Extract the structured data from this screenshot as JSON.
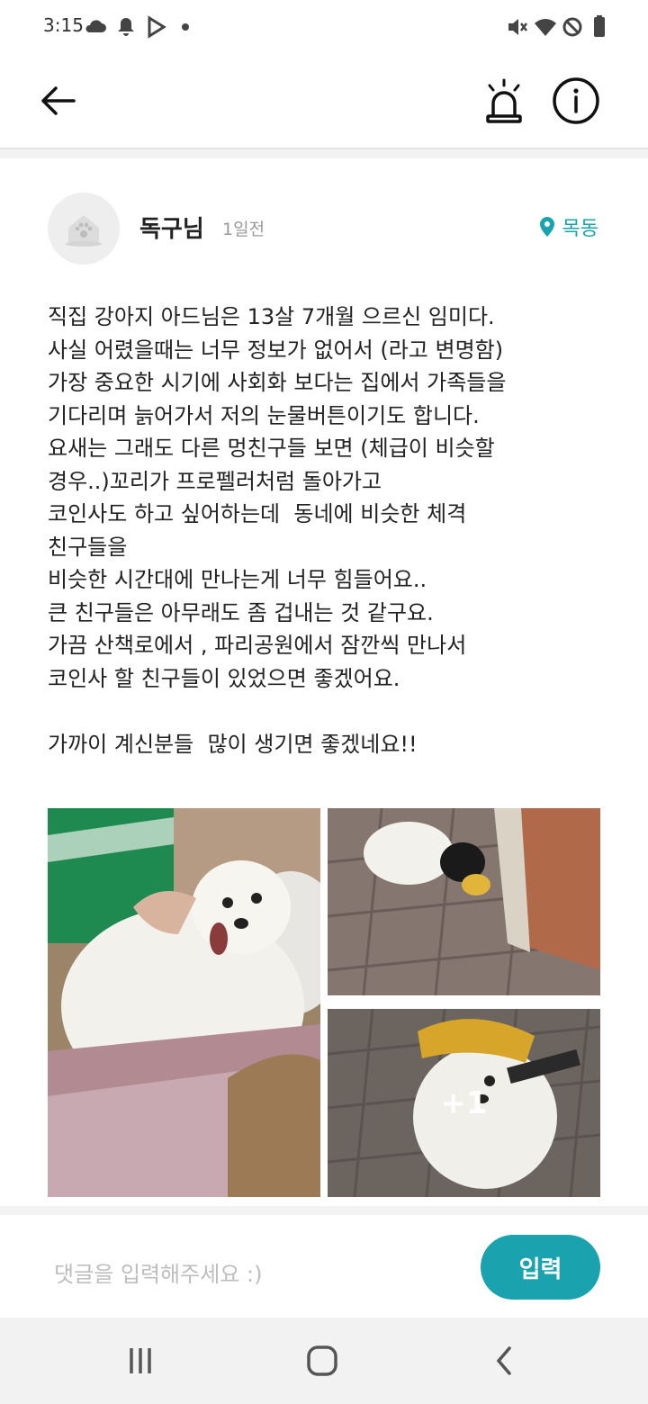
{
  "status_bar": {
    "time": "3:15",
    "left_icons": [
      "cloud-icon",
      "bell-icon",
      "play-store-icon",
      "dot-icon"
    ],
    "right_icons": [
      "mute-icon",
      "wifi-icon",
      "do-not-disturb-icon",
      "battery-icon"
    ]
  },
  "app_bar": {
    "back_icon": "arrow-left-icon",
    "report_icon": "siren-icon",
    "info_icon": "info-icon"
  },
  "post": {
    "author": "독구님",
    "time_ago": "1일전",
    "location": "목동",
    "body": "직집 강아지 아드님은 13살 7개월 으르신 임미다.\n사실 어렸을때는 너무 정보가 없어서 (라고 변명함)\n가장 중요한 시기에 사회화 보다는 집에서 가족들을\n기다리며 늙어가서 저의 눈물버튼이기도 합니다.\n요새는 그래도 다른 멍친구들 보면 (체급이 비슷할\n경우..)꼬리가 프로펠러처럼 돌아가고\n코인사도 하고 싶어하는데  동네에 비슷한 체격\n친구들을\n비슷한 시간대에 만나는게 너무 힘들어요..\n큰 친구들은 아무래도 좀 겁내는 것 같구요.\n가끔 산책로에서 , 파리공원에서 잠깐씩 만나서\n코인사 할 친구들이 있었으면 좋겠어요.\n\n가까이 계신분들  많이 생기면 좋겠네요!!",
    "extra_photos_label": "+1"
  },
  "comment": {
    "placeholder": "댓글을 입력해주세요 :)",
    "submit_label": "입력"
  },
  "colors": {
    "accent": "#1aa3ae",
    "background": "#ffffff",
    "divider": "#f2f2f2"
  }
}
